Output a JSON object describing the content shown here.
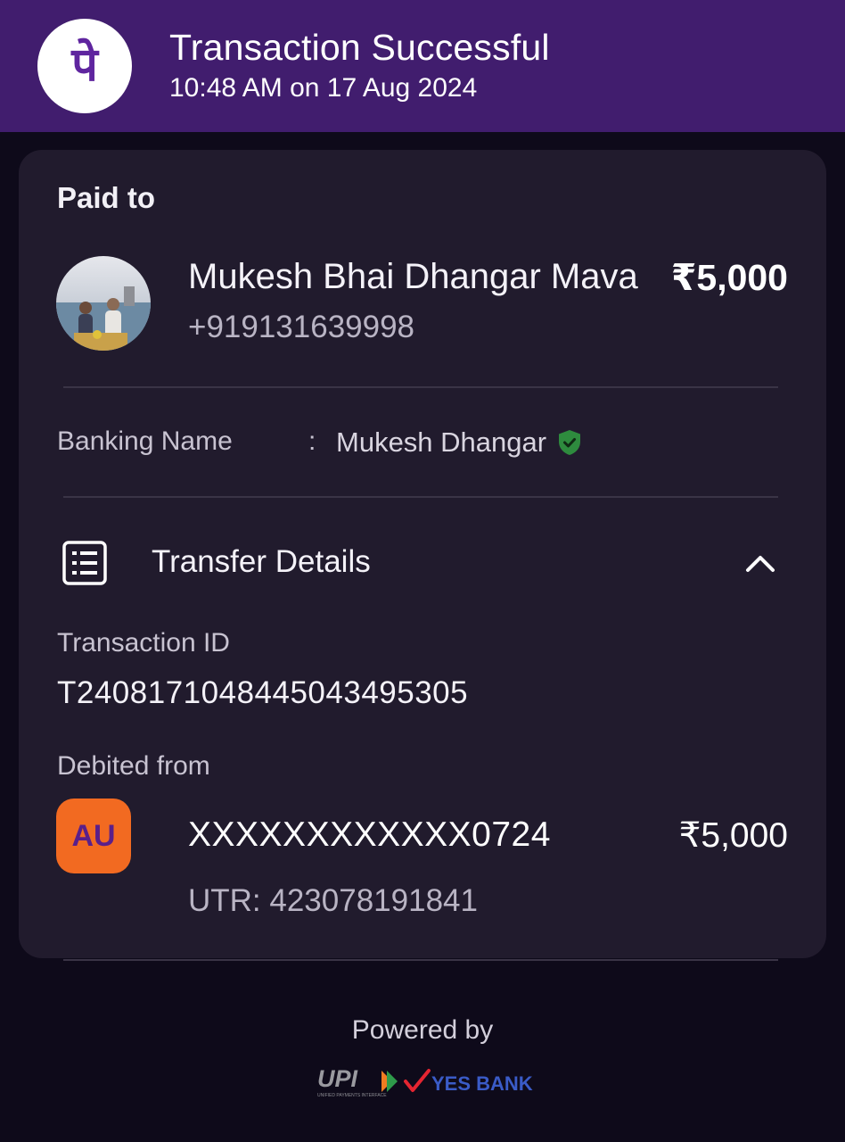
{
  "header": {
    "title": "Transaction Successful",
    "time": "10:48 AM on 17 Aug 2024",
    "logo_glyph": "पे",
    "logo_icon": "phonepe-logo-icon",
    "background": "#411d6e"
  },
  "payee": {
    "section_label": "Paid to",
    "name": "Mukesh Bhai Dhangar Mava",
    "amount": "₹5,000",
    "phone": "+919131639998"
  },
  "banking_name": {
    "label": "Banking Name",
    "separator": ":",
    "value": "Mukesh Dhangar",
    "verified_icon": "shield-check-icon",
    "verified_color": "#2e8b3e"
  },
  "transfer_details": {
    "title": "Transfer Details",
    "icon": "receipt-list-icon",
    "toggle_icon": "chevron-up-icon",
    "transaction_id_label": "Transaction ID",
    "transaction_id": "T2408171048445043495305",
    "debited_from_label": "Debited from",
    "bank_logo_text": "AU",
    "bank_logo_color": "#f26a21",
    "account": "XXXXXXXXXXXX0724",
    "amount": "₹5,000",
    "utr": "UTR: 423078191841"
  },
  "footer": {
    "powered_by": "Powered by",
    "upi_logo_text": "UPI",
    "upi_tagline": "UNIFIED PAYMENTS INTERFACE",
    "bank_partner": "YES BANK"
  }
}
